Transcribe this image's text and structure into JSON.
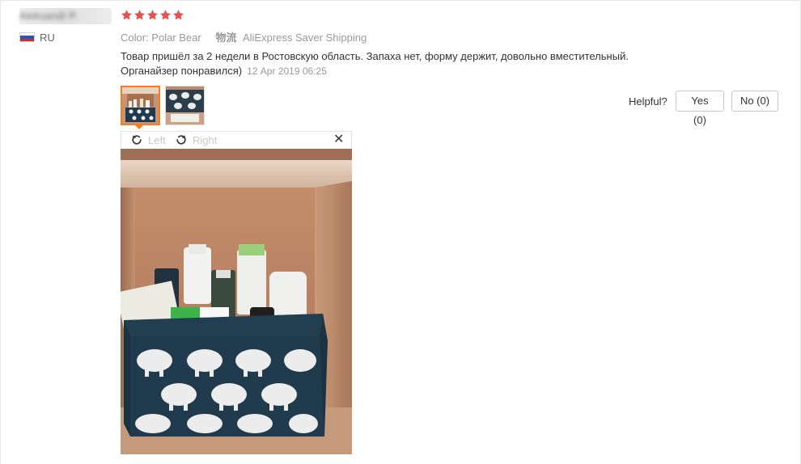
{
  "reviewer": {
    "name": "Aleksandr P.",
    "country_code": "RU"
  },
  "rating": {
    "stars": 5,
    "max": 5,
    "color": "#f04d4d"
  },
  "meta": {
    "color_attr": "Color: Polar Bear",
    "logistics_label": "物流",
    "shipping": "AliExpress Saver Shipping"
  },
  "review": {
    "text_line1": "Товар пришёл за 2 недели в Ростовскую область. Запаха нет, форму держит, довольно вместительный.",
    "text_line2": "Органайзер понравился)",
    "date": "12 Apr 2019 06:25"
  },
  "helpful": {
    "label": "Helpful?",
    "yes_label": "Yes (0)",
    "no_label": "No (0)"
  },
  "viewer": {
    "rotate_left_label": "Left",
    "rotate_right_label": "Right",
    "close_label": "✕"
  },
  "colors": {
    "accent_orange": "#ff7a1a",
    "muted_text": "#999999",
    "basket_navy": "#1f3b4d"
  }
}
